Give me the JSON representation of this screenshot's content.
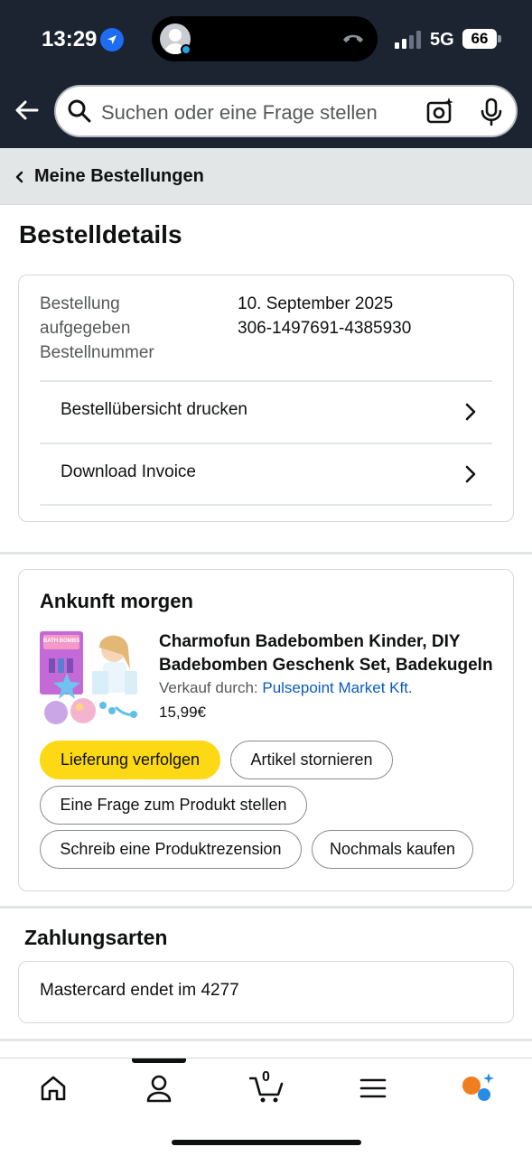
{
  "status_bar": {
    "time": "13:29",
    "network": "5G",
    "battery": "66"
  },
  "search": {
    "placeholder": "Suchen oder eine Frage stellen"
  },
  "breadcrumb": {
    "label": "Meine Bestellungen"
  },
  "page_title": "Bestelldetails",
  "order_summary": {
    "placed_label_line1": "Bestellung",
    "placed_label_line2": "aufgegeben",
    "number_label": "Bestellnummer",
    "placed_value": "10. September 2025",
    "number_value": "306-1497691-4385930",
    "links": [
      {
        "label": "Bestellübersicht drucken"
      },
      {
        "label": "Download Invoice"
      }
    ]
  },
  "shipment": {
    "heading": "Ankunft morgen",
    "product": {
      "title_line1": "Charmofun Badebomben Kinder, DIY",
      "title_line2": "Badebomben Geschenk Set, Badekugeln",
      "sold_by_label": "Verkauf durch:",
      "seller": "Pulsepoint Market Kft.",
      "price": "15,99€",
      "image_text": "BATH BOMBS"
    },
    "actions": {
      "track": "Lieferung verfolgen",
      "cancel": "Artikel stornieren",
      "question": "Eine Frage zum Produkt stellen",
      "review": "Schreib eine Produktrezension",
      "buy_again": "Nochmals kaufen"
    }
  },
  "payment": {
    "heading": "Zahlungsarten",
    "card_brand": "Mastercard",
    "card_info": "endet im 4277"
  },
  "bottom_nav": {
    "items": [
      "home-icon",
      "account-icon",
      "cart-icon",
      "menu-icon",
      "rufus-ai-icon"
    ],
    "cart_count": "0"
  },
  "colors": {
    "header_bg": "#1c2431",
    "accent_yellow": "#fdd814",
    "link_blue": "#0b5ac2",
    "breadcrumb_bg": "#e3e6e6"
  }
}
